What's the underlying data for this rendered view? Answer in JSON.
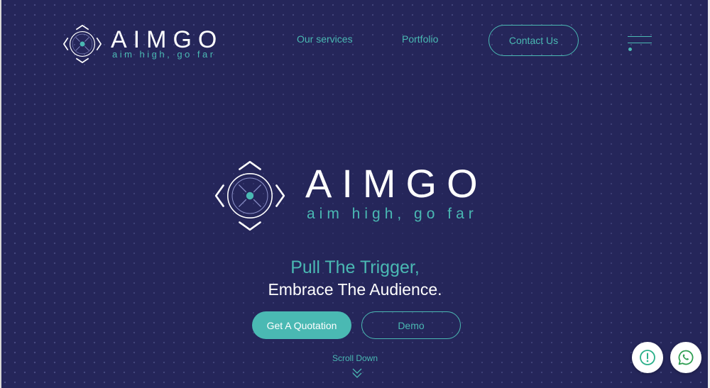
{
  "brand": {
    "name": "AIMGO",
    "tagline": "aim high, go far"
  },
  "nav": {
    "services": "Our services",
    "portfolio": "Portfolio",
    "contact": "Contact Us"
  },
  "hero": {
    "line1": "Pull The Trigger,",
    "line2": "Embrace The Audience.",
    "primary_cta": "Get A Quotation",
    "secondary_cta": "Demo",
    "scroll_label": "Scroll Down"
  },
  "colors": {
    "background": "#25265a",
    "accent": "#4ab9b3",
    "text": "#ffffff"
  },
  "icons": {
    "menu": "hamburger-menu-icon",
    "scroll": "chevron-double-down-icon",
    "alert": "exclamation-circle-icon",
    "chat": "whatsapp-icon"
  }
}
